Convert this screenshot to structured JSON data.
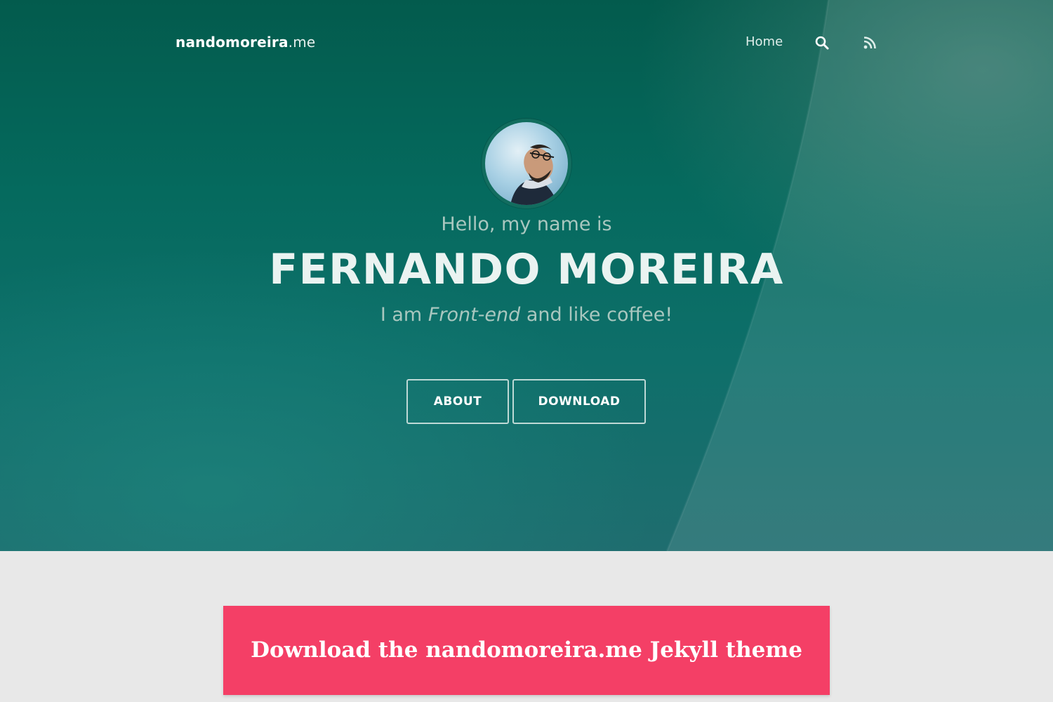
{
  "header": {
    "logo_strong": "nandomoreira",
    "logo_light": ".me",
    "nav": {
      "home_label": "Home",
      "search_icon": "search-icon",
      "rss_icon": "rss-icon"
    }
  },
  "hero": {
    "greeting": "Hello, my name is",
    "name": "FERNANDO MOREIRA",
    "tagline_prefix": "I am ",
    "tagline_role": "Front-end",
    "tagline_suffix": " and like coffee!",
    "buttons": {
      "about": "ABOUT",
      "download": "DOWNLOAD"
    }
  },
  "banner": {
    "text": "Download the nandomoreira.me Jekyll theme"
  },
  "colors": {
    "hero_teal": "#056a5e",
    "banner_pink": "#f43f66",
    "page_bg": "#e8e8e8"
  }
}
